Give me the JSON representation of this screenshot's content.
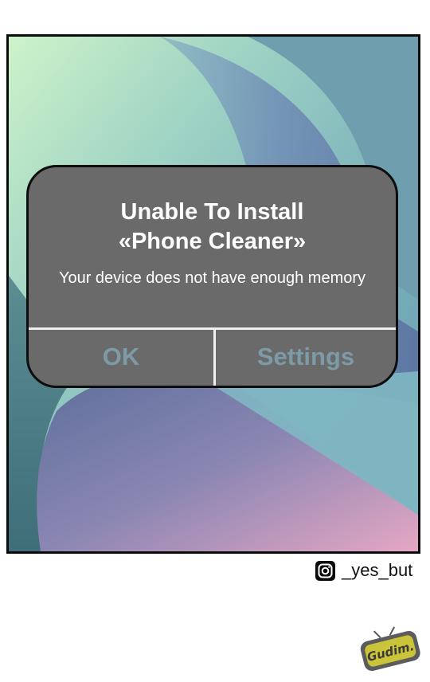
{
  "dialog": {
    "title_line1": "Unable To Install",
    "title_line2": "«Phone Cleaner»",
    "message": "Your device does not have enough memory",
    "ok_label": "OK",
    "settings_label": "Settings"
  },
  "footer": {
    "instagram_handle": "_yes_but",
    "logo_text": "Gudim."
  },
  "colors": {
    "dialog_background": "#6a6a6a",
    "button_text": "#7d9aa7",
    "panel_border": "#0b0b0b"
  }
}
